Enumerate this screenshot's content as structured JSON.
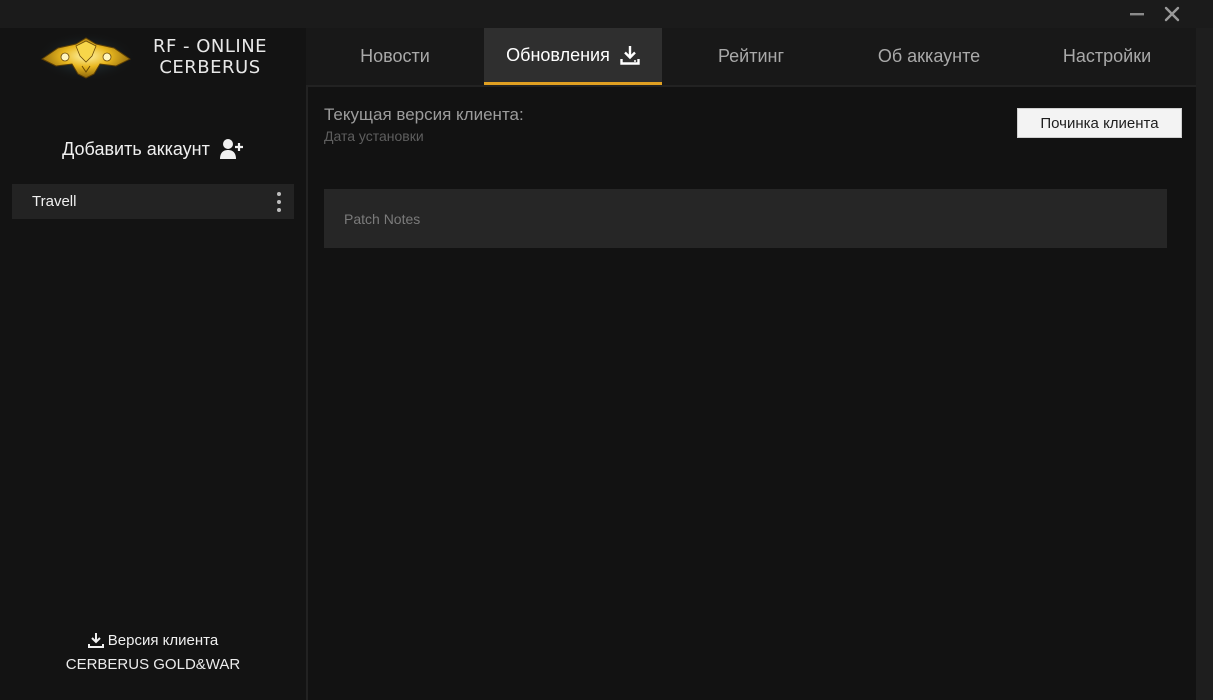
{
  "window": {
    "controls": {
      "minimize_icon": "minimize-icon",
      "close_icon": "close-icon"
    }
  },
  "sidebar": {
    "brand": {
      "line1": "RF - ONLINE",
      "line2": "CERBERUS"
    },
    "add_account": {
      "label": "Добавить аккаунт",
      "icon": "add-user-icon"
    },
    "accounts": [
      {
        "name": "Travell"
      }
    ],
    "client_version": {
      "label": "Версия клиента",
      "value": "CERBERUS GOLD&WAR"
    }
  },
  "tabs": [
    {
      "label": "Новости",
      "active": false
    },
    {
      "label": "Обновления",
      "active": true,
      "icon": "download-icon"
    },
    {
      "label": "Рейтинг",
      "active": false
    },
    {
      "label": "Об аккаунте",
      "active": false
    },
    {
      "label": "Настройки",
      "active": false
    }
  ],
  "main": {
    "current_version_label": "Текущая версия клиента:",
    "install_date_label": "Дата установки",
    "repair_button": "Починка клиента",
    "patch_notes_label": "Patch Notes"
  },
  "colors": {
    "accent": "#e0a022",
    "background": "#121212",
    "sidebar": "#131313",
    "active_tab": "#2f2f2f"
  }
}
